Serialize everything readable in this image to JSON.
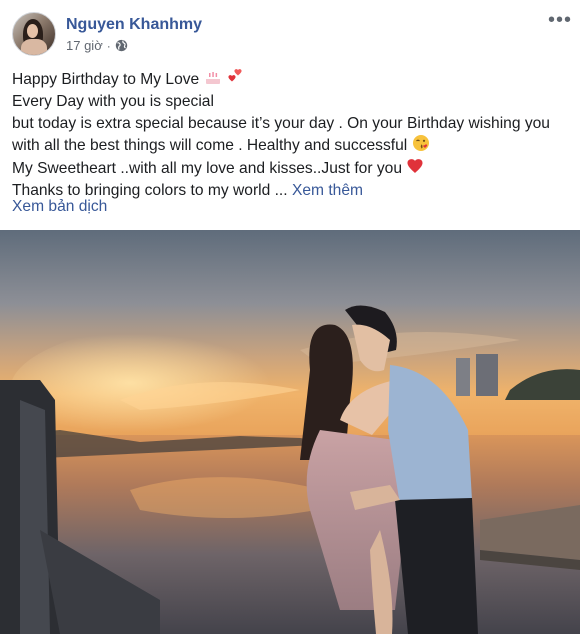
{
  "post": {
    "author": "Nguyen Khanhmy",
    "time": "17 giờ",
    "separator": "·",
    "privacy_icon": "globe-icon",
    "more_icon": "more-options-icon",
    "lines": [
      "Happy Birthday to My Love",
      "Every Day with you is special",
      "but today is extra special because it’s your day . On your Birthday wishing you with all the best things will come . Healthy and successful",
      "My Sweetheart ..with all my love and kisses..Just for you",
      "Thanks to bringing colors to my world ..."
    ],
    "see_more": "Xem thêm",
    "translate": "Xem bản dịch",
    "emojis": [
      "birthday-cake-icon",
      "hearts-icon",
      "kiss-face-icon",
      "red-heart-icon"
    ],
    "photo": "couple-kissing-at-sunset-riverside-photo"
  },
  "colors": {
    "link": "#385898",
    "text": "#1c1e21",
    "meta": "#616770"
  }
}
